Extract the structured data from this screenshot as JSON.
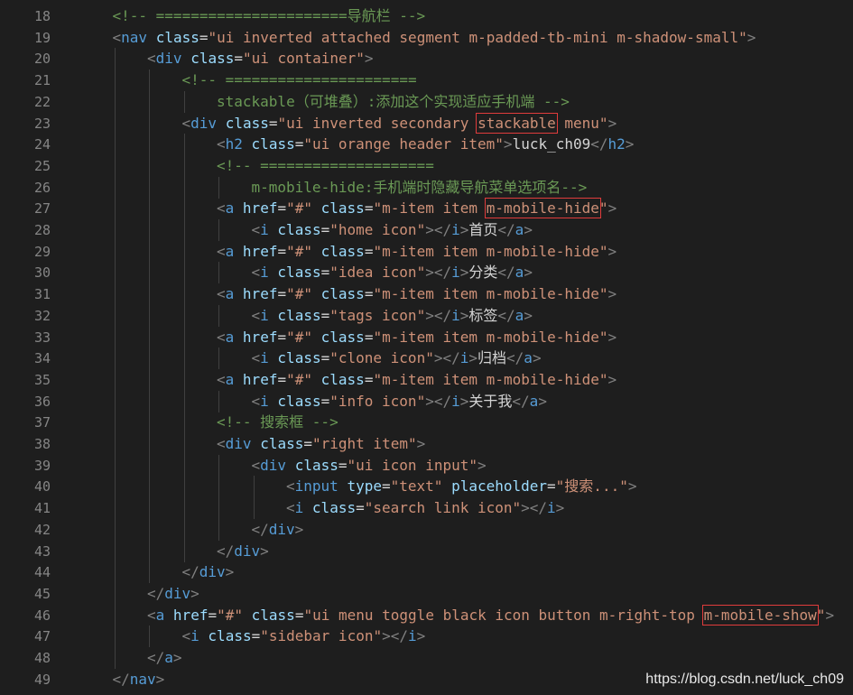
{
  "editor": {
    "background": "#1e1e1e",
    "colors": {
      "tag": "#569cd6",
      "attr": "#9cdcfe",
      "string": "#ce9178",
      "comment": "#6a9955",
      "text": "#d4d4d4",
      "punct": "#808080",
      "line_number": "#858585",
      "highlight_box": "#e03c3c"
    },
    "lines": [
      {
        "n": "18",
        "indent": 1,
        "tokens": [
          [
            "cmt",
            "<!-- ======================导航栏 -->"
          ]
        ]
      },
      {
        "n": "19",
        "indent": 1,
        "tokens": [
          [
            "pun",
            "<"
          ],
          [
            "tag",
            "nav"
          ],
          [
            "txt",
            " "
          ],
          [
            "attr",
            "class"
          ],
          [
            "txt",
            "="
          ],
          [
            "str",
            "\"ui inverted attached segment m-padded-tb-mini m-shadow-small\""
          ],
          [
            "pun",
            ">"
          ]
        ]
      },
      {
        "n": "20",
        "indent": 2,
        "tokens": [
          [
            "pun",
            "<"
          ],
          [
            "tag",
            "div"
          ],
          [
            "txt",
            " "
          ],
          [
            "attr",
            "class"
          ],
          [
            "txt",
            "="
          ],
          [
            "str",
            "\"ui container\""
          ],
          [
            "pun",
            ">"
          ]
        ]
      },
      {
        "n": "21",
        "indent": 3,
        "tokens": [
          [
            "cmt",
            "<!-- ======================"
          ]
        ]
      },
      {
        "n": "22",
        "indent": 4,
        "tokens": [
          [
            "cmt",
            "stackable（可堆叠）:添加这个实现适应手机端 -->"
          ]
        ]
      },
      {
        "n": "23",
        "indent": 3,
        "tokens": [
          [
            "pun",
            "<"
          ],
          [
            "tag",
            "div"
          ],
          [
            "txt",
            " "
          ],
          [
            "attr",
            "class"
          ],
          [
            "txt",
            "="
          ],
          [
            "str",
            "\"ui inverted secondary "
          ],
          [
            "str",
            "stackable",
            "hl"
          ],
          [
            "str",
            " menu\""
          ],
          [
            "pun",
            ">"
          ]
        ]
      },
      {
        "n": "24",
        "indent": 4,
        "tokens": [
          [
            "pun",
            "<"
          ],
          [
            "tag",
            "h2"
          ],
          [
            "txt",
            " "
          ],
          [
            "attr",
            "class"
          ],
          [
            "txt",
            "="
          ],
          [
            "str",
            "\"ui orange header item\""
          ],
          [
            "pun",
            ">"
          ],
          [
            "txt",
            "luck_ch09"
          ],
          [
            "pun",
            "</"
          ],
          [
            "tag",
            "h2"
          ],
          [
            "pun",
            ">"
          ]
        ]
      },
      {
        "n": "25",
        "indent": 4,
        "tokens": [
          [
            "cmt",
            "<!-- ===================="
          ]
        ]
      },
      {
        "n": "26",
        "indent": 5,
        "tokens": [
          [
            "cmt",
            "m-mobile-hide:手机端时隐藏导航菜单选项名-->"
          ]
        ]
      },
      {
        "n": "27",
        "indent": 4,
        "tokens": [
          [
            "pun",
            "<"
          ],
          [
            "tag",
            "a"
          ],
          [
            "txt",
            " "
          ],
          [
            "attr",
            "href"
          ],
          [
            "txt",
            "="
          ],
          [
            "str",
            "\"#\""
          ],
          [
            "txt",
            " "
          ],
          [
            "attr",
            "class"
          ],
          [
            "txt",
            "="
          ],
          [
            "str",
            "\"m-item item "
          ],
          [
            "str",
            "m-mobile-hide",
            "hl"
          ],
          [
            "str",
            "\""
          ],
          [
            "pun",
            ">"
          ]
        ]
      },
      {
        "n": "28",
        "indent": 5,
        "tokens": [
          [
            "pun",
            "<"
          ],
          [
            "tag",
            "i"
          ],
          [
            "txt",
            " "
          ],
          [
            "attr",
            "class"
          ],
          [
            "txt",
            "="
          ],
          [
            "str",
            "\"home icon\""
          ],
          [
            "pun",
            "></"
          ],
          [
            "tag",
            "i"
          ],
          [
            "pun",
            ">"
          ],
          [
            "txt",
            "首页"
          ],
          [
            "pun",
            "</"
          ],
          [
            "tag",
            "a"
          ],
          [
            "pun",
            ">"
          ]
        ]
      },
      {
        "n": "29",
        "indent": 4,
        "tokens": [
          [
            "pun",
            "<"
          ],
          [
            "tag",
            "a"
          ],
          [
            "txt",
            " "
          ],
          [
            "attr",
            "href"
          ],
          [
            "txt",
            "="
          ],
          [
            "str",
            "\"#\""
          ],
          [
            "txt",
            " "
          ],
          [
            "attr",
            "class"
          ],
          [
            "txt",
            "="
          ],
          [
            "str",
            "\"m-item item m-mobile-hide\""
          ],
          [
            "pun",
            ">"
          ]
        ]
      },
      {
        "n": "30",
        "indent": 5,
        "tokens": [
          [
            "pun",
            "<"
          ],
          [
            "tag",
            "i"
          ],
          [
            "txt",
            " "
          ],
          [
            "attr",
            "class"
          ],
          [
            "txt",
            "="
          ],
          [
            "str",
            "\"idea icon\""
          ],
          [
            "pun",
            "></"
          ],
          [
            "tag",
            "i"
          ],
          [
            "pun",
            ">"
          ],
          [
            "txt",
            "分类"
          ],
          [
            "pun",
            "</"
          ],
          [
            "tag",
            "a"
          ],
          [
            "pun",
            ">"
          ]
        ]
      },
      {
        "n": "31",
        "indent": 4,
        "tokens": [
          [
            "pun",
            "<"
          ],
          [
            "tag",
            "a"
          ],
          [
            "txt",
            " "
          ],
          [
            "attr",
            "href"
          ],
          [
            "txt",
            "="
          ],
          [
            "str",
            "\"#\""
          ],
          [
            "txt",
            " "
          ],
          [
            "attr",
            "class"
          ],
          [
            "txt",
            "="
          ],
          [
            "str",
            "\"m-item item m-mobile-hide\""
          ],
          [
            "pun",
            ">"
          ]
        ]
      },
      {
        "n": "32",
        "indent": 5,
        "tokens": [
          [
            "pun",
            "<"
          ],
          [
            "tag",
            "i"
          ],
          [
            "txt",
            " "
          ],
          [
            "attr",
            "class"
          ],
          [
            "txt",
            "="
          ],
          [
            "str",
            "\"tags icon\""
          ],
          [
            "pun",
            "></"
          ],
          [
            "tag",
            "i"
          ],
          [
            "pun",
            ">"
          ],
          [
            "txt",
            "标签"
          ],
          [
            "pun",
            "</"
          ],
          [
            "tag",
            "a"
          ],
          [
            "pun",
            ">"
          ]
        ]
      },
      {
        "n": "33",
        "indent": 4,
        "tokens": [
          [
            "pun",
            "<"
          ],
          [
            "tag",
            "a"
          ],
          [
            "txt",
            " "
          ],
          [
            "attr",
            "href"
          ],
          [
            "txt",
            "="
          ],
          [
            "str",
            "\"#\""
          ],
          [
            "txt",
            " "
          ],
          [
            "attr",
            "class"
          ],
          [
            "txt",
            "="
          ],
          [
            "str",
            "\"m-item item m-mobile-hide\""
          ],
          [
            "pun",
            ">"
          ]
        ]
      },
      {
        "n": "34",
        "indent": 5,
        "tokens": [
          [
            "pun",
            "<"
          ],
          [
            "tag",
            "i"
          ],
          [
            "txt",
            " "
          ],
          [
            "attr",
            "class"
          ],
          [
            "txt",
            "="
          ],
          [
            "str",
            "\"clone icon\""
          ],
          [
            "pun",
            "></"
          ],
          [
            "tag",
            "i"
          ],
          [
            "pun",
            ">"
          ],
          [
            "txt",
            "归档"
          ],
          [
            "pun",
            "</"
          ],
          [
            "tag",
            "a"
          ],
          [
            "pun",
            ">"
          ]
        ]
      },
      {
        "n": "35",
        "indent": 4,
        "tokens": [
          [
            "pun",
            "<"
          ],
          [
            "tag",
            "a"
          ],
          [
            "txt",
            " "
          ],
          [
            "attr",
            "href"
          ],
          [
            "txt",
            "="
          ],
          [
            "str",
            "\"#\""
          ],
          [
            "txt",
            " "
          ],
          [
            "attr",
            "class"
          ],
          [
            "txt",
            "="
          ],
          [
            "str",
            "\"m-item item m-mobile-hide\""
          ],
          [
            "pun",
            ">"
          ]
        ]
      },
      {
        "n": "36",
        "indent": 5,
        "tokens": [
          [
            "pun",
            "<"
          ],
          [
            "tag",
            "i"
          ],
          [
            "txt",
            " "
          ],
          [
            "attr",
            "class"
          ],
          [
            "txt",
            "="
          ],
          [
            "str",
            "\"info icon\""
          ],
          [
            "pun",
            "></"
          ],
          [
            "tag",
            "i"
          ],
          [
            "pun",
            ">"
          ],
          [
            "txt",
            "关于我"
          ],
          [
            "pun",
            "</"
          ],
          [
            "tag",
            "a"
          ],
          [
            "pun",
            ">"
          ]
        ]
      },
      {
        "n": "37",
        "indent": 4,
        "tokens": [
          [
            "cmt",
            "<!-- 搜索框 -->"
          ]
        ]
      },
      {
        "n": "38",
        "indent": 4,
        "tokens": [
          [
            "pun",
            "<"
          ],
          [
            "tag",
            "div"
          ],
          [
            "txt",
            " "
          ],
          [
            "attr",
            "class"
          ],
          [
            "txt",
            "="
          ],
          [
            "str",
            "\"right item\""
          ],
          [
            "pun",
            ">"
          ]
        ]
      },
      {
        "n": "39",
        "indent": 5,
        "tokens": [
          [
            "pun",
            "<"
          ],
          [
            "tag",
            "div"
          ],
          [
            "txt",
            " "
          ],
          [
            "attr",
            "class"
          ],
          [
            "txt",
            "="
          ],
          [
            "str",
            "\"ui icon input\""
          ],
          [
            "pun",
            ">"
          ]
        ]
      },
      {
        "n": "40",
        "indent": 6,
        "tokens": [
          [
            "pun",
            "<"
          ],
          [
            "tag",
            "input"
          ],
          [
            "txt",
            " "
          ],
          [
            "attr",
            "type"
          ],
          [
            "txt",
            "="
          ],
          [
            "str",
            "\"text\""
          ],
          [
            "txt",
            " "
          ],
          [
            "attr",
            "placeholder"
          ],
          [
            "txt",
            "="
          ],
          [
            "str",
            "\"搜索...\""
          ],
          [
            "pun",
            ">"
          ]
        ]
      },
      {
        "n": "41",
        "indent": 6,
        "tokens": [
          [
            "pun",
            "<"
          ],
          [
            "tag",
            "i"
          ],
          [
            "txt",
            " "
          ],
          [
            "attr",
            "class"
          ],
          [
            "txt",
            "="
          ],
          [
            "str",
            "\"search link icon\""
          ],
          [
            "pun",
            "></"
          ],
          [
            "tag",
            "i"
          ],
          [
            "pun",
            ">"
          ]
        ]
      },
      {
        "n": "42",
        "indent": 5,
        "tokens": [
          [
            "pun",
            "</"
          ],
          [
            "tag",
            "div"
          ],
          [
            "pun",
            ">"
          ]
        ]
      },
      {
        "n": "43",
        "indent": 4,
        "tokens": [
          [
            "pun",
            "</"
          ],
          [
            "tag",
            "div"
          ],
          [
            "pun",
            ">"
          ]
        ]
      },
      {
        "n": "44",
        "indent": 3,
        "tokens": [
          [
            "pun",
            "</"
          ],
          [
            "tag",
            "div"
          ],
          [
            "pun",
            ">"
          ]
        ]
      },
      {
        "n": "45",
        "indent": 2,
        "tokens": [
          [
            "pun",
            "</"
          ],
          [
            "tag",
            "div"
          ],
          [
            "pun",
            ">"
          ]
        ]
      },
      {
        "n": "46",
        "indent": 2,
        "tokens": [
          [
            "pun",
            "<"
          ],
          [
            "tag",
            "a"
          ],
          [
            "txt",
            " "
          ],
          [
            "attr",
            "href"
          ],
          [
            "txt",
            "="
          ],
          [
            "str",
            "\"#\""
          ],
          [
            "txt",
            " "
          ],
          [
            "attr",
            "class"
          ],
          [
            "txt",
            "="
          ],
          [
            "str",
            "\"ui menu toggle black icon button m-right-top "
          ],
          [
            "str",
            "m-mobile-show",
            "hl"
          ],
          [
            "str",
            "\""
          ],
          [
            "pun",
            ">"
          ]
        ]
      },
      {
        "n": "47",
        "indent": 3,
        "tokens": [
          [
            "pun",
            "<"
          ],
          [
            "tag",
            "i"
          ],
          [
            "txt",
            " "
          ],
          [
            "attr",
            "class"
          ],
          [
            "txt",
            "="
          ],
          [
            "str",
            "\"sidebar icon\""
          ],
          [
            "pun",
            "></"
          ],
          [
            "tag",
            "i"
          ],
          [
            "pun",
            ">"
          ]
        ]
      },
      {
        "n": "48",
        "indent": 2,
        "tokens": [
          [
            "pun",
            "</"
          ],
          [
            "tag",
            "a"
          ],
          [
            "pun",
            ">"
          ]
        ]
      },
      {
        "n": "49",
        "indent": 1,
        "tokens": [
          [
            "pun",
            "</"
          ],
          [
            "tag",
            "nav"
          ],
          [
            "pun",
            ">"
          ]
        ]
      }
    ]
  },
  "watermark": "https://blog.csdn.net/luck_ch09"
}
